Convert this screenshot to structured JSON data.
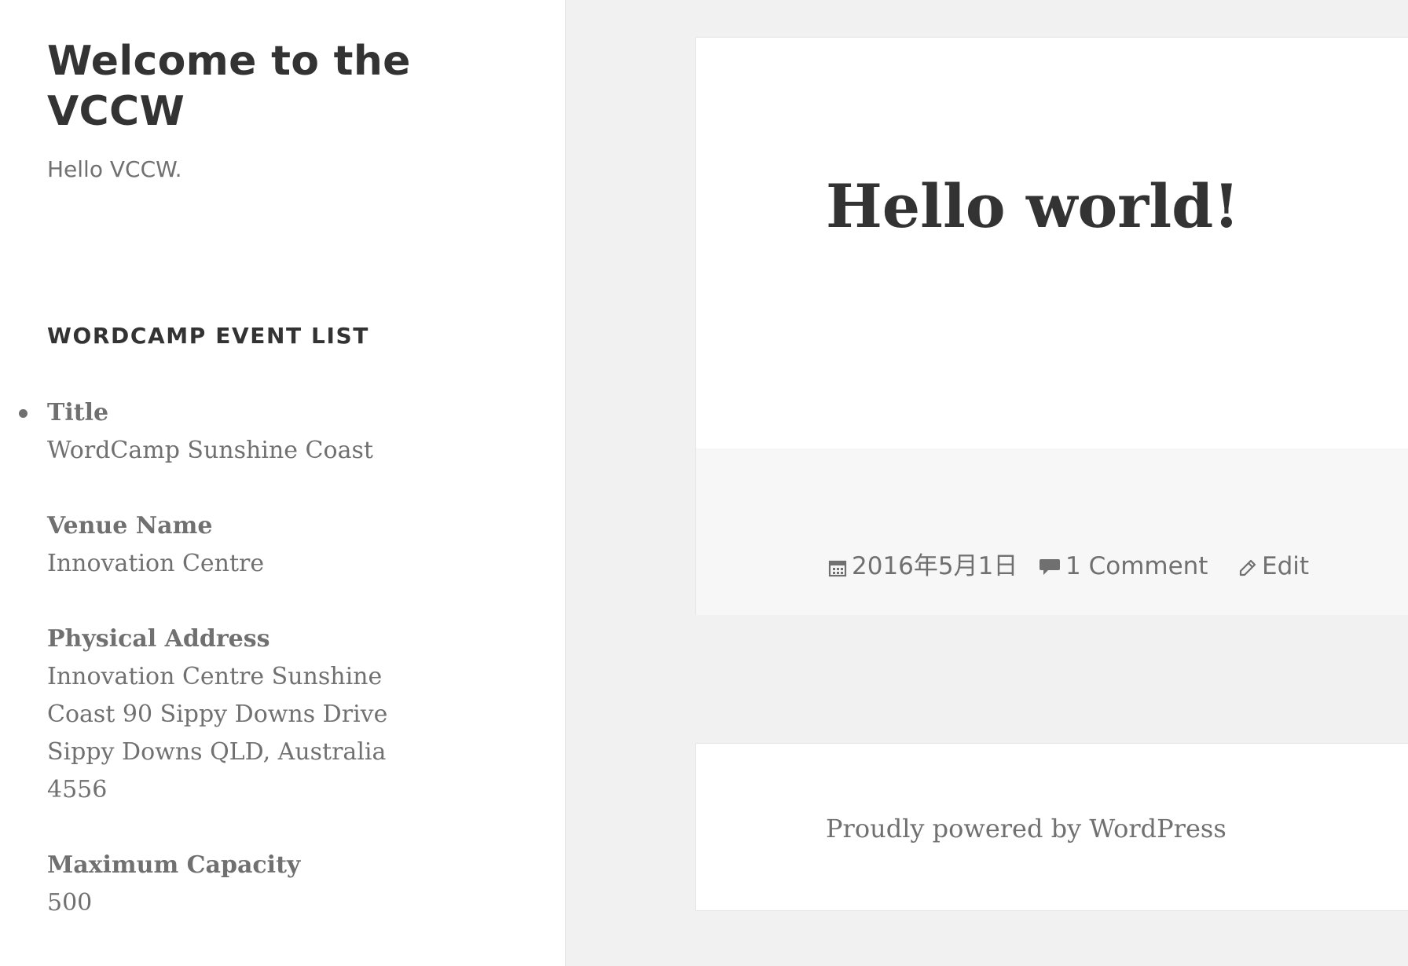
{
  "site": {
    "title": "Welcome to the VCCW",
    "description": "Hello VCCW."
  },
  "widget": {
    "title": "WORDCAMP EVENT LIST",
    "event": {
      "title_label": "Title",
      "title_value": "WordCamp Sunshine Coast",
      "venue_label": "Venue Name",
      "venue_value": "Innovation Centre",
      "address_label": "Physical Address",
      "address_value": "Innovation Centre Sunshine Coast 90 Sippy Downs Drive Sippy Downs QLD, Australia 4556",
      "capacity_label": "Maximum Capacity",
      "capacity_value": "500"
    }
  },
  "post": {
    "title": "Hello world!",
    "date": "2016年5月1日",
    "comments": "1 Comment",
    "edit": "Edit",
    "icons": {
      "date": "calendar-icon",
      "comments": "comment-bubble-icon",
      "edit": "pencil-icon"
    }
  },
  "footer": {
    "credit": "Proudly powered by WordPress"
  },
  "colors": {
    "background": "#f1f1f1",
    "panel": "#ffffff",
    "heading": "#333333",
    "meta": "#707070",
    "post_footer": "#f7f7f7"
  }
}
